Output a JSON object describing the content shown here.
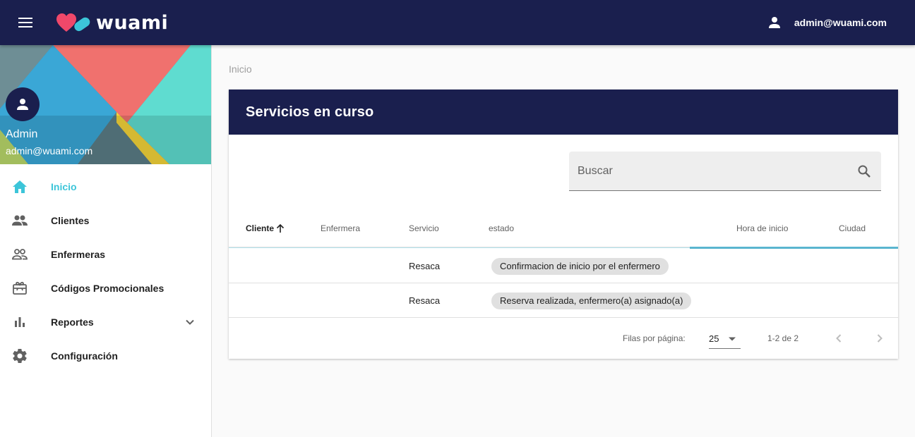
{
  "header": {
    "brand": "wuami",
    "user_email": "admin@wuami.com",
    "brand_colors": {
      "heart": "#f0486a",
      "pill": "#3cc5d9",
      "bar": "#1a1f4e"
    }
  },
  "sidebar": {
    "profile_name": "Admin",
    "profile_email": "admin@wuami.com",
    "items": [
      {
        "label": "Inicio",
        "icon": "home-icon",
        "active": true
      },
      {
        "label": "Clientes",
        "icon": "people-icon"
      },
      {
        "label": "Enfermeras",
        "icon": "people-outline-icon"
      },
      {
        "label": "Códigos Promocionales",
        "icon": "card-giftcard-icon"
      },
      {
        "label": "Reportes",
        "icon": "bar-chart-icon",
        "expandable": true
      },
      {
        "label": "Configuración",
        "icon": "gear-icon"
      }
    ]
  },
  "main": {
    "breadcrumb": "Inicio",
    "card_title": "Servicios en curso",
    "search_placeholder": "Buscar",
    "columns": [
      "Cliente",
      "Enfermera",
      "Servicio",
      "estado",
      "Hora de inicio",
      "Ciudad"
    ],
    "sorted_column": "Cliente",
    "rows": [
      {
        "cliente": "",
        "enfermera": "",
        "servicio": "Resaca",
        "estado": "Confirmacion de inicio por el enfermero",
        "hora": "",
        "ciudad": ""
      },
      {
        "cliente": "",
        "enfermera": "",
        "servicio": "Resaca",
        "estado": "Reserva realizada, enfermero(a) asignado(a)",
        "hora": "",
        "ciudad": ""
      }
    ],
    "pagination": {
      "rows_per_page_label": "Filas por página:",
      "rows_per_page": "25",
      "range": "1-2 de 2"
    }
  }
}
